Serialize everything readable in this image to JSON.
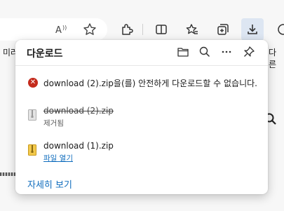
{
  "toolbar": {
    "icons": [
      "read-aloud-icon",
      "favorite-star-icon",
      "extensions-icon",
      "split-screen-icon",
      "favorites-icon",
      "collections-icon",
      "downloads-icon"
    ],
    "left_partial_text": "미러",
    "right_partial_text": "다른"
  },
  "downloads_flyout": {
    "title": "다운로드",
    "actions": [
      "open-folder-icon",
      "search-icon",
      "more-icon",
      "pin-icon"
    ],
    "items": [
      {
        "type": "error",
        "name": "download (2).zip을(를) 안전하게 다운로드할 수 없습니다."
      },
      {
        "type": "removed",
        "name": "download (2).zip",
        "status": "제거됨"
      },
      {
        "type": "complete",
        "name": "download (1).zip",
        "link": "파일 열기"
      }
    ],
    "see_more": "자세히 보기"
  },
  "colors": {
    "accent": "#0f6cbd",
    "error": "#c42b1c",
    "download_button_bg": "#dde6f2"
  }
}
